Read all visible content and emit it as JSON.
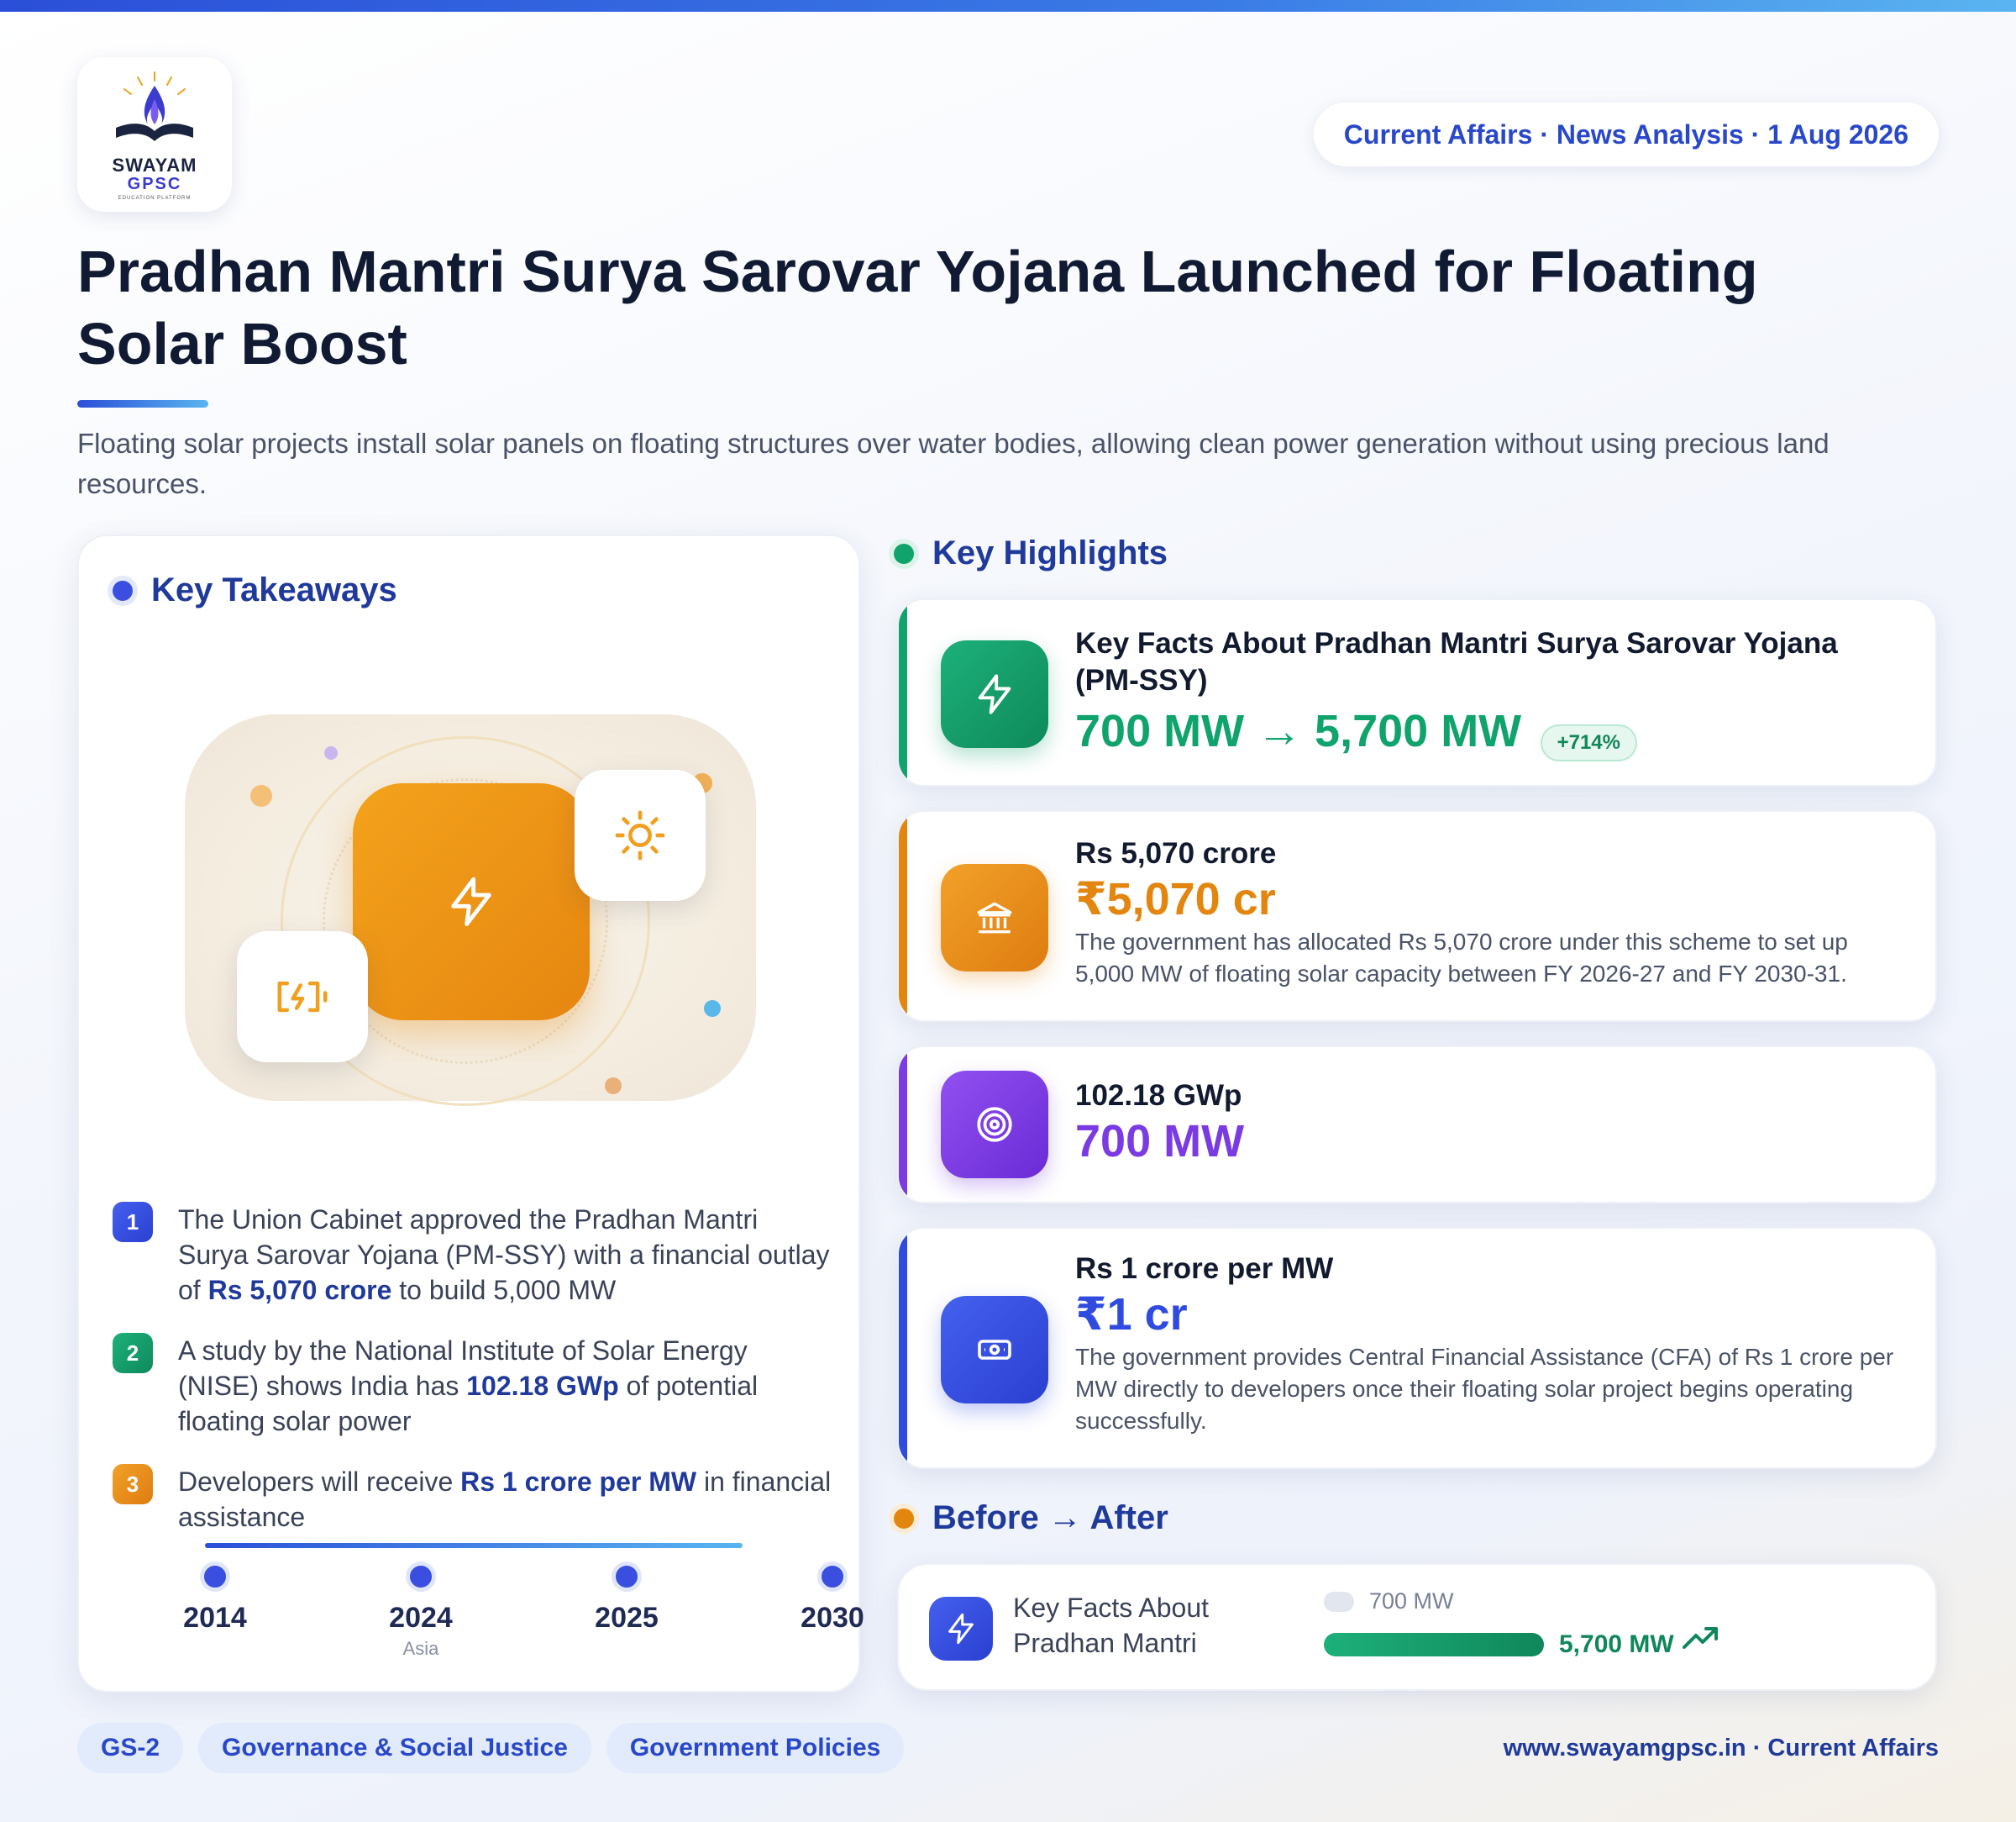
{
  "logo": {
    "line1": "SWAYAM",
    "line2": "GPSC",
    "line3": "EDUCATION PLATFORM"
  },
  "header": {
    "date_pill": "Current Affairs · News Analysis · 1 Aug 2026"
  },
  "title": "Pradhan Mantri Surya Sarovar Yojana Launched for Floating Solar Boost",
  "subtitle": "Floating solar projects install solar panels on floating structures over water bodies, allowing clean power generation without using precious land resources.",
  "takeaways": {
    "heading": "Key Takeaways",
    "items": [
      {
        "num": "1",
        "pre": "The Union Cabinet approved the Pradhan Mantri Surya Sarovar Yojana (PM-SSY) with a financial outlay of ",
        "bold": "Rs 5,070 crore",
        "post": " to build 5,000 MW"
      },
      {
        "num": "2",
        "pre": "A study by the National Institute of Solar Energy (NISE) shows India has ",
        "bold": "102.18 GWp",
        "post": " of potential floating solar power"
      },
      {
        "num": "3",
        "pre": "Developers will receive ",
        "bold": "Rs 1 crore per MW",
        "post": " in financial assistance"
      }
    ],
    "timeline": [
      {
        "year": "2014",
        "sub": ""
      },
      {
        "year": "2024",
        "sub": "Asia"
      },
      {
        "year": "2025",
        "sub": ""
      },
      {
        "year": "2030",
        "sub": ""
      }
    ]
  },
  "highlights": {
    "heading": "Key Highlights",
    "cards": [
      {
        "title": "Key Facts About Pradhan Mantri Surya Sarovar Yojana (PM-SSY)",
        "value": "700 MW → 5,700 MW",
        "badge": "+714%",
        "desc": "",
        "icon": "lightning-icon",
        "color": "#10a36c"
      },
      {
        "title": "Rs 5,070 crore",
        "value": "₹5,070 cr",
        "desc": "The government has allocated Rs 5,070 crore under this scheme to set up 5,000 MW of floating solar capacity between FY 2026-27 and FY 2030-31.",
        "icon": "bank-icon",
        "color": "#e3860f"
      },
      {
        "title": "102.18 GWp",
        "value": "700 MW",
        "desc": "",
        "icon": "target-icon",
        "color": "#7b3be3"
      },
      {
        "title": "Rs 1 crore per MW",
        "value": "₹1 cr",
        "desc": "The government provides Central Financial Assistance (CFA) of Rs 1 crore per MW directly to developers once their floating solar project begins operating successfully.",
        "icon": "money-icon",
        "color": "#2f4be0"
      }
    ]
  },
  "before_after": {
    "heading": "Before → After",
    "label": "Key Facts About Pradhan Mantri",
    "before": "700 MW",
    "after": "5,700 MW"
  },
  "footer": {
    "tags": [
      "GS-2",
      "Governance & Social Justice",
      "Government Policies"
    ],
    "site": "www.swayamgpsc.in · Current Affairs"
  }
}
